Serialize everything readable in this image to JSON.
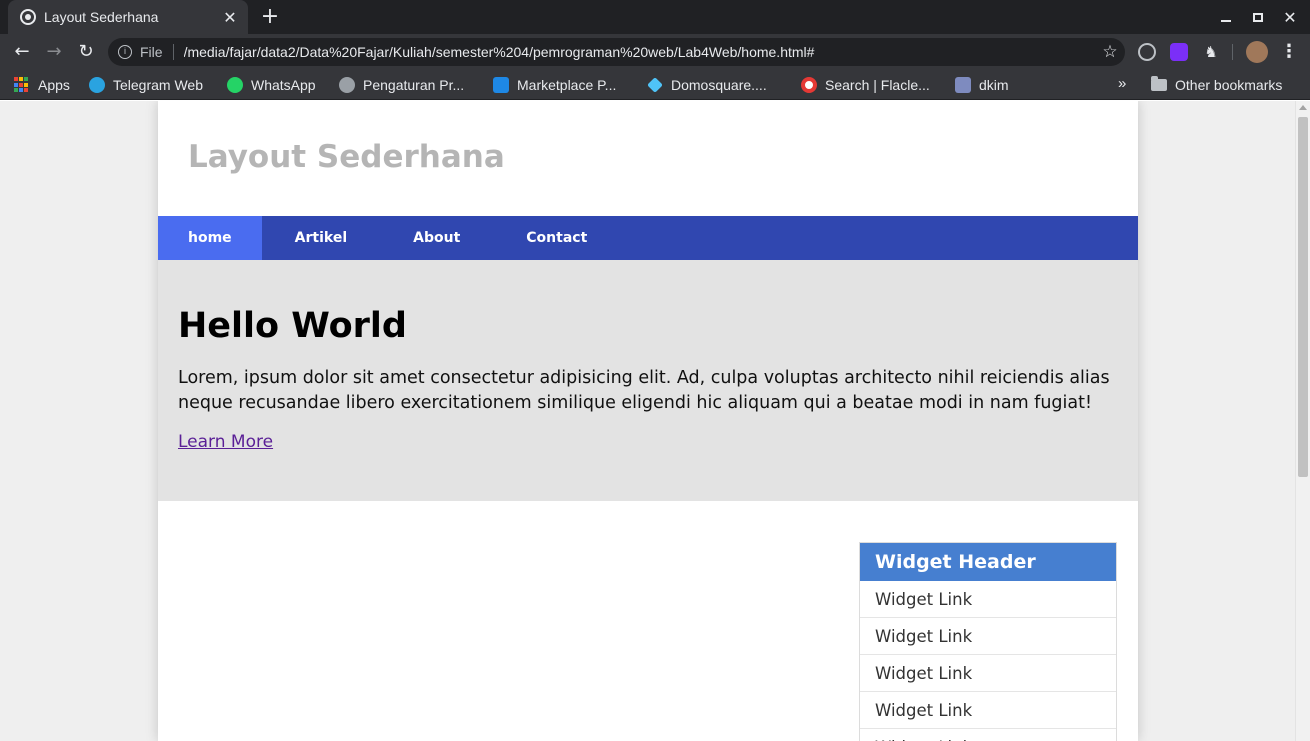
{
  "browser": {
    "tab_title": "Layout Sederhana",
    "new_tab_symbol": "+",
    "scheme_label": "File",
    "url": "/media/fajar/data2/Data%20Fajar/Kuliah/semester%204/pemrograman%20web/Lab4Web/home.html#",
    "bookmarks": [
      {
        "label": "Apps",
        "icon": "apps-grid-icon"
      },
      {
        "label": "Telegram Web",
        "icon": "telegram-icon",
        "color": "#2aa3e0"
      },
      {
        "label": "WhatsApp",
        "icon": "whatsapp-icon",
        "color": "#25d366"
      },
      {
        "label": "Pengaturan Pr...",
        "icon": "settings-bug-icon",
        "color": "#9aa0a6"
      },
      {
        "label": "Marketplace P...",
        "icon": "marketplace-icon",
        "color": "#1e88e5"
      },
      {
        "label": "Domosquare....",
        "icon": "domosquare-icon",
        "color": "#4fc3f7"
      },
      {
        "label": "Search | Flacle...",
        "icon": "flacle-icon",
        "color": "#e53935"
      },
      {
        "label": "dkim",
        "icon": "puzzle-icon",
        "color": "#7e8bbf"
      }
    ],
    "more_bookmarks": "»",
    "other_bookmarks": "Other bookmarks"
  },
  "page": {
    "site_title": "Layout Sederhana",
    "nav": [
      {
        "label": "home",
        "active": true
      },
      {
        "label": "Artikel",
        "active": false
      },
      {
        "label": "About",
        "active": false
      },
      {
        "label": "Contact",
        "active": false
      }
    ],
    "hero": {
      "heading": "Hello World",
      "text": "Lorem, ipsum dolor sit amet consectetur adipisicing elit. Ad, culpa voluptas architecto nihil reiciendis alias neque recusandae libero exercitationem similique eligendi hic aliquam qui a beatae modi in nam fugiat!",
      "link": "Learn More"
    },
    "widget": {
      "header": "Widget Header",
      "links": [
        "Widget Link",
        "Widget Link",
        "Widget Link",
        "Widget Link",
        "Widget Link"
      ]
    }
  },
  "colors": {
    "nav_bg": "#3047b0",
    "nav_active": "#4a6cf0",
    "widget_header": "#467fd0",
    "hero_bg": "#e3e3e3",
    "site_title": "#b5b5b5"
  }
}
